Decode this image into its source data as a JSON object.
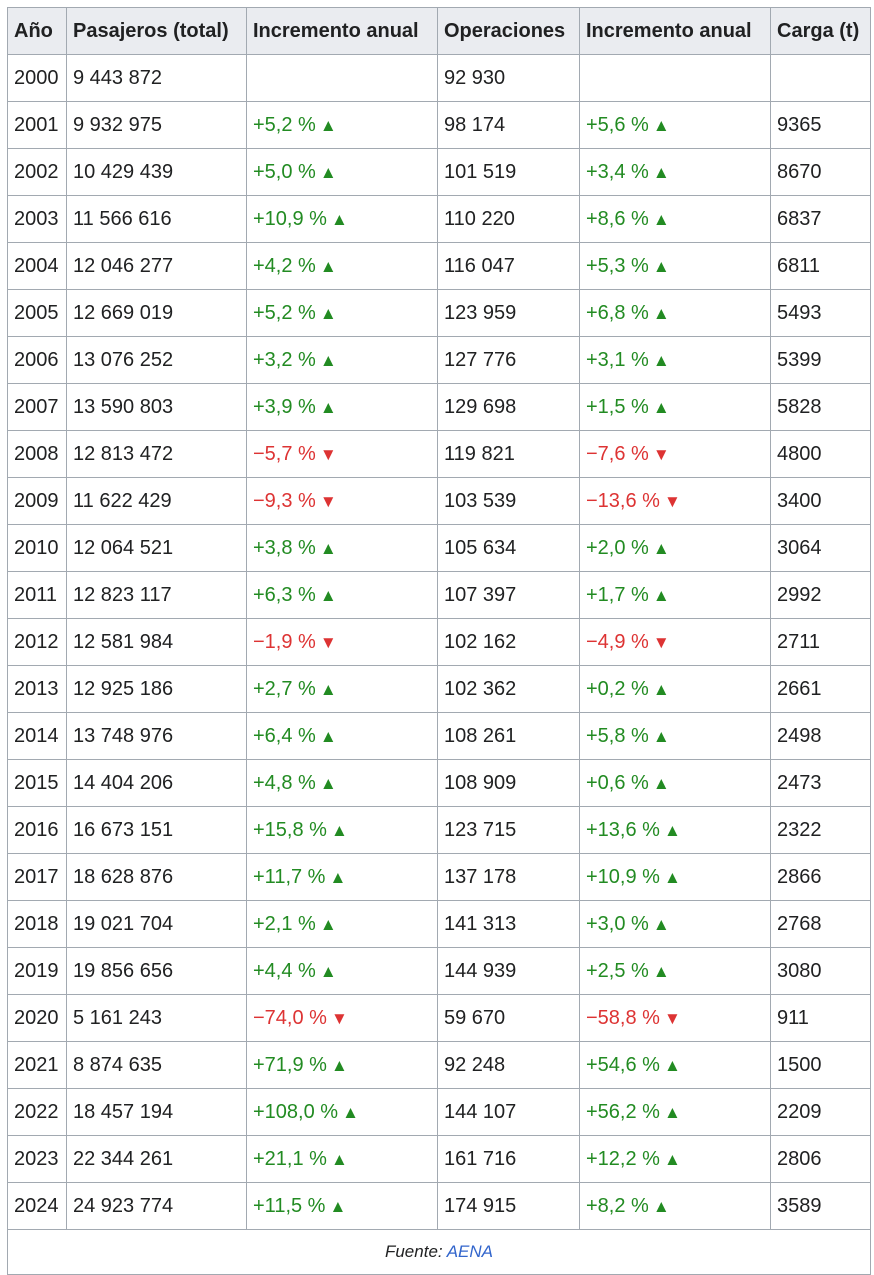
{
  "headers": [
    "Año",
    "Pasajeros (total)",
    "Incremento anual",
    "Operaciones",
    "Incremento anual",
    "Carga (t)"
  ],
  "rows": [
    [
      "2000",
      "9 443 872",
      "",
      "92 930",
      "",
      ""
    ],
    [
      "2001",
      "9 932 975",
      "+5,2 %",
      "98 174",
      "+5,6 %",
      "9365"
    ],
    [
      "2002",
      "10 429 439",
      "+5,0 %",
      "101 519",
      "+3,4 %",
      "8670"
    ],
    [
      "2003",
      "11 566 616",
      "+10,9 %",
      "110 220",
      "+8,6 %",
      "6837"
    ],
    [
      "2004",
      "12 046 277",
      "+4,2 %",
      "116 047",
      "+5,3 %",
      "6811"
    ],
    [
      "2005",
      "12 669 019",
      "+5,2 %",
      "123 959",
      "+6,8 %",
      "5493"
    ],
    [
      "2006",
      "13 076 252",
      "+3,2 %",
      "127 776",
      "+3,1 %",
      "5399"
    ],
    [
      "2007",
      "13 590 803",
      "+3,9 %",
      "129 698",
      "+1,5 %",
      "5828"
    ],
    [
      "2008",
      "12 813 472",
      "−5,7 %",
      "119 821",
      "−7,6 %",
      "4800"
    ],
    [
      "2009",
      "11 622 429",
      "−9,3 %",
      "103 539",
      "−13,6 %",
      "3400"
    ],
    [
      "2010",
      "12 064 521",
      "+3,8 %",
      "105 634",
      "+2,0 %",
      "3064"
    ],
    [
      "2011",
      "12 823 117",
      "+6,3 %",
      "107 397",
      "+1,7 %",
      "2992"
    ],
    [
      "2012",
      "12 581 984",
      "−1,9 %",
      "102 162",
      "−4,9 %",
      "2711"
    ],
    [
      "2013",
      "12 925 186",
      "+2,7 %",
      "102 362",
      "+0,2 %",
      "2661"
    ],
    [
      "2014",
      "13 748 976",
      "+6,4 %",
      "108 261",
      "+5,8 %",
      "2498"
    ],
    [
      "2015",
      "14 404 206",
      "+4,8 %",
      "108 909",
      "+0,6 %",
      "2473"
    ],
    [
      "2016",
      "16 673 151",
      "+15,8 %",
      "123 715",
      "+13,6 %",
      "2322"
    ],
    [
      "2017",
      "18 628 876",
      "+11,7 %",
      "137 178",
      "+10,9 %",
      "2866"
    ],
    [
      "2018",
      "19 021 704",
      "+2,1 %",
      "141 313",
      "+3,0 %",
      "2768"
    ],
    [
      "2019",
      "19 856 656",
      "+4,4 %",
      "144 939",
      "+2,5 %",
      "3080"
    ],
    [
      "2020",
      "5 161 243",
      "−74,0 %",
      "59 670",
      "−58,8 %",
      "911"
    ],
    [
      "2021",
      "8 874 635",
      "+71,9 %",
      "92 248",
      "+54,6 %",
      "1500"
    ],
    [
      "2022",
      "18 457 194",
      "+108,0 %",
      "144 107",
      "+56,2 %",
      "2209"
    ],
    [
      "2023",
      "22 344 261",
      "+21,1 %",
      "161 716",
      "+12,2 %",
      "2806"
    ],
    [
      "2024",
      "24 923 774",
      "+11,5 %",
      "174 915",
      "+8,2 %",
      "3589"
    ]
  ],
  "footer": {
    "label": "Fuente: ",
    "link": "AENA"
  },
  "colors": {
    "increase": "#228b22",
    "decrease": "#dd3333",
    "header_bg": "#eaecf0",
    "border": "#a2a9b1"
  },
  "icons": {
    "increase": "triangle-up-icon",
    "decrease": "triangle-down-icon"
  }
}
